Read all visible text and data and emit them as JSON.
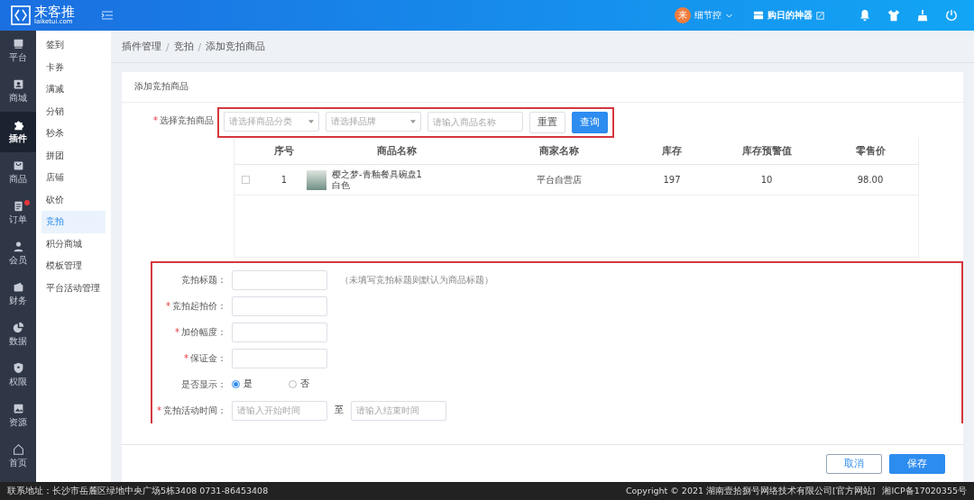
{
  "header": {
    "logo_text": "来客推",
    "logo_domain": "laiketui.com",
    "user": {
      "avatar_text": "来",
      "name": "细节控"
    },
    "store": {
      "name": "购日的神器"
    }
  },
  "nav": [
    {
      "label": "平台",
      "selected": false
    },
    {
      "label": "商城",
      "selected": false
    },
    {
      "label": "插件",
      "selected": true
    },
    {
      "label": "商品",
      "selected": false
    },
    {
      "label": "订单",
      "selected": false,
      "badge": true
    },
    {
      "label": "会员",
      "selected": false
    },
    {
      "label": "财务",
      "selected": false
    },
    {
      "label": "数据",
      "selected": false
    },
    {
      "label": "权限",
      "selected": false
    },
    {
      "label": "资源",
      "selected": false
    },
    {
      "label": "首页",
      "selected": false
    }
  ],
  "submenu": [
    {
      "label": "签到",
      "selected": false
    },
    {
      "label": "卡券",
      "selected": false
    },
    {
      "label": "满减",
      "selected": false
    },
    {
      "label": "分销",
      "selected": false
    },
    {
      "label": "秒杀",
      "selected": false
    },
    {
      "label": "拼团",
      "selected": false
    },
    {
      "label": "店铺",
      "selected": false
    },
    {
      "label": "砍价",
      "selected": false
    },
    {
      "label": "竞拍",
      "selected": true
    },
    {
      "label": "积分商城",
      "selected": false
    },
    {
      "label": "模板管理",
      "selected": false
    },
    {
      "label": "平台活动管理",
      "selected": false
    }
  ],
  "breadcrumb": {
    "separator": "/",
    "items": [
      "插件管理",
      "竞拍",
      "添加竞拍商品"
    ]
  },
  "card_title": "添加竞拍商品",
  "filter": {
    "required_mark": "*",
    "label": "选择竞拍商品",
    "highlighted": true,
    "category_placeholder": "请选择商品分类",
    "brand_placeholder": "请选择品牌",
    "name_placeholder": "请输入商品名称",
    "reset": "重置",
    "query": "查询"
  },
  "table": {
    "columns": [
      "序号",
      "商品名称",
      "商家名称",
      "库存",
      "库存预警值",
      "零售价"
    ],
    "rows": [
      {
        "checked": false,
        "index": "1",
        "name": "樱之梦-青釉餐具碗盘1",
        "spec": "白色",
        "merchant": "平台自营店",
        "stock": "197",
        "warning": "10",
        "price": "98.00"
      }
    ]
  },
  "form": {
    "highlighted": true,
    "fields": [
      {
        "kind": "text",
        "label": "竞拍标题：",
        "hint": "（未填写竞拍标题则默认为商品标题）"
      },
      {
        "kind": "text",
        "required_mark": "*",
        "label": "竞拍起拍价："
      },
      {
        "kind": "text",
        "required_mark": "*",
        "label": "加价幅度："
      },
      {
        "kind": "text",
        "required_mark": "*",
        "label": "保证金："
      },
      {
        "kind": "radio",
        "label": "是否显示：",
        "options": [
          {
            "label": "是",
            "selected": true
          },
          {
            "label": "否",
            "selected": false
          }
        ]
      },
      {
        "kind": "range",
        "required_mark": "*",
        "label": "竞拍活动时间：",
        "start_placeholder": "请输入开始时间",
        "separator": "至",
        "end_placeholder": "请输入结束时间"
      }
    ]
  },
  "actions": {
    "cancel": "取消",
    "save": "保存"
  },
  "footer": {
    "address": "联系地址：长沙市岳麓区绿地中央广场5栋3408 0731-86453408",
    "copyright": "Copyright © 2021 湖南壹拾捌号网络技术有限公司[官方网站]",
    "icp": "湘ICP备17020355号"
  }
}
